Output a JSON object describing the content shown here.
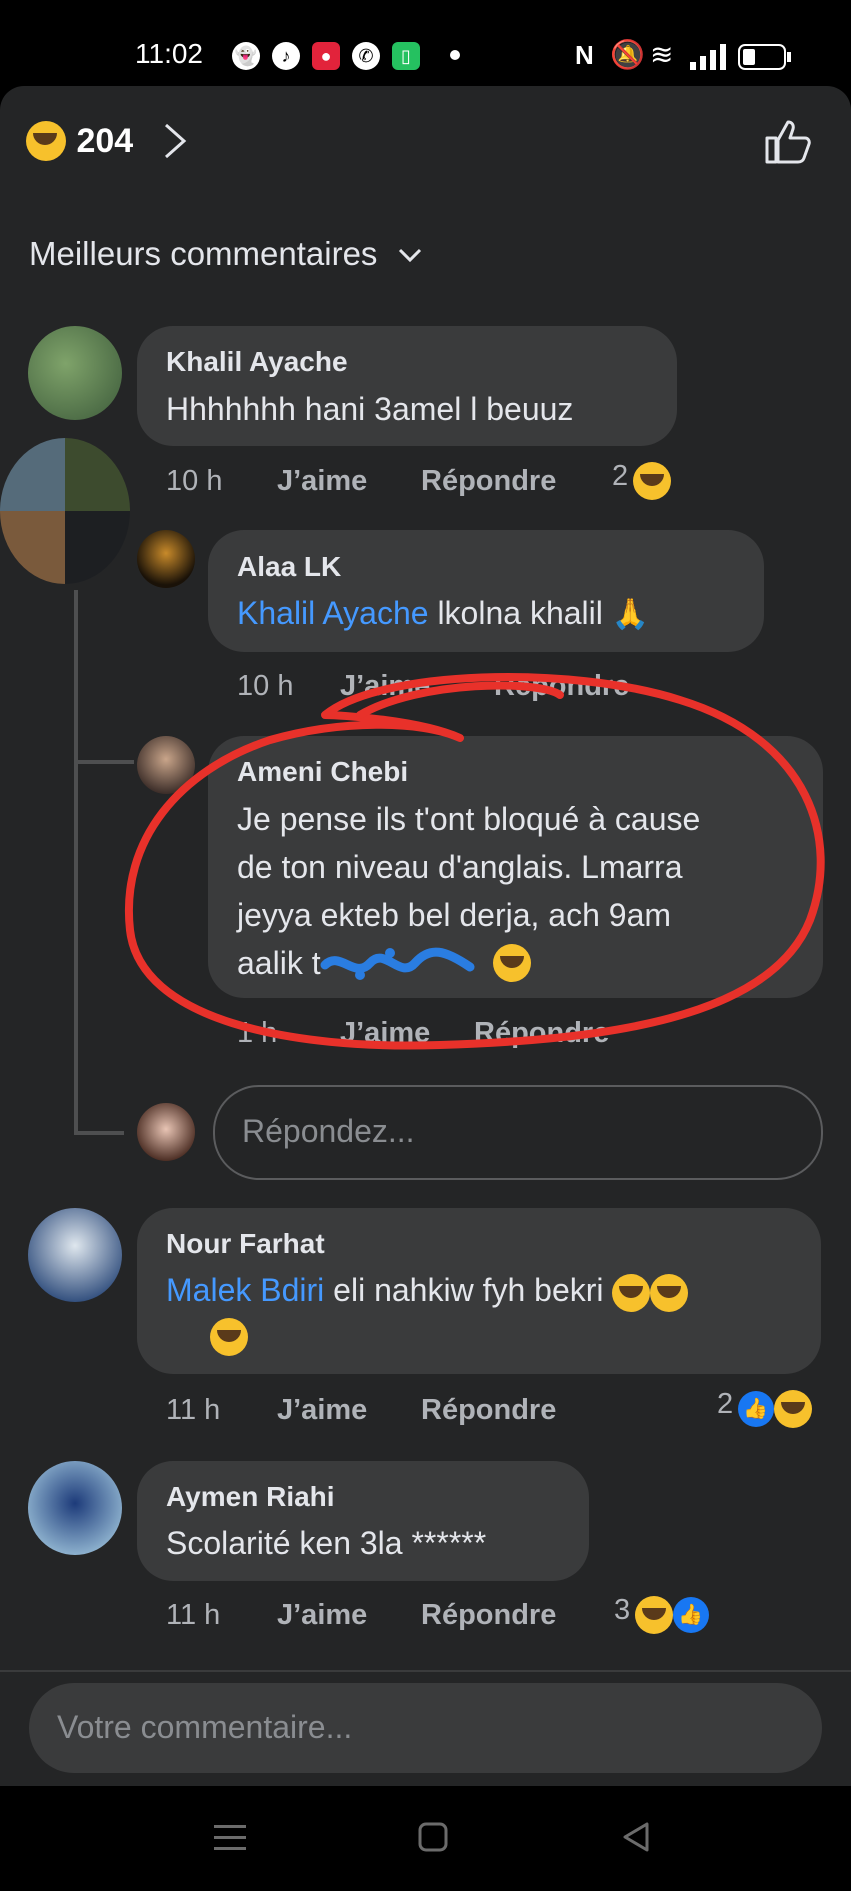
{
  "status_bar": {
    "time": "11:02"
  },
  "header": {
    "reaction_count": "204",
    "sort_label": "Meilleurs commentaires"
  },
  "comments": [
    {
      "author": "Khalil Ayache",
      "text": "Hhhhhhh hani 3amel l beuuz",
      "time": "10 h",
      "like": "J’aime",
      "reply": "Répondre",
      "reactions": "2"
    },
    {
      "author": "Alaa LK",
      "mention": "Khalil Ayache",
      "text": " lkolna khalil",
      "time": "10 h",
      "like": "J’aime",
      "reply": "Répondre"
    },
    {
      "author": "Ameni Chebi",
      "lines": [
        "Je pense ils t'ont bloqué à cause",
        "de ton niveau d'anglais. Lmarra",
        "jeyya ekteb bel derja, ach 9am",
        "aalik t"
      ],
      "time": "1 h",
      "like": "J’aime",
      "reply": "Répondre"
    },
    {
      "author": "Nour Farhat",
      "mention": "Malek Bdiri",
      "text": " eli nahkiw fyh bekri",
      "time": "11 h",
      "like": "J’aime",
      "reply": "Répondre",
      "reactions": "2"
    },
    {
      "author": "Aymen Riahi",
      "text": "Scolarité ken 3la ******",
      "time": "11 h",
      "like": "J’aime",
      "reply": "Répondre",
      "reactions": "3"
    }
  ],
  "reply_input": {
    "placeholder": "Répondez..."
  },
  "comment_input": {
    "placeholder": "Votre commentaire..."
  },
  "colors": {
    "background": "#242526",
    "bubble": "#3a3b3c",
    "mention": "#4599ff",
    "annotation": "#e8312a",
    "scribble": "#2a7de1"
  },
  "icons": [
    "haha-emoji-icon",
    "chevron-right-icon",
    "like-outline-icon",
    "chevron-down-icon",
    "pray-emoji-icon",
    "like-reaction-icon",
    "menu-nav-icon",
    "home-nav-icon",
    "back-nav-icon"
  ]
}
